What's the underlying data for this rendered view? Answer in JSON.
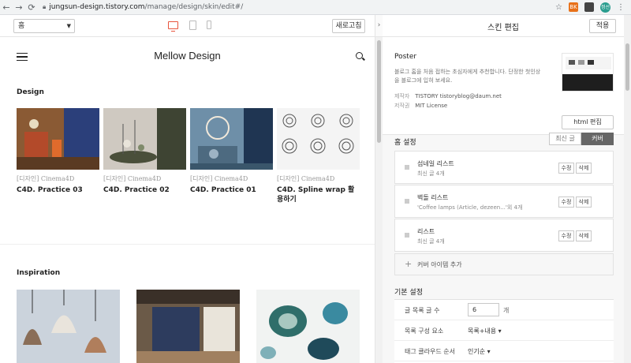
{
  "browser": {
    "back": "←",
    "forward": "→",
    "reload": "C",
    "url_domain": "jungsun-design.tistory.com",
    "url_path": "/manage/design/skin/edit#/",
    "ext1": "BK",
    "ext2": "",
    "avatar": "정선"
  },
  "toolbar": {
    "page_select": "홈",
    "refresh": "새로고침"
  },
  "preview": {
    "blog_title": "Mellow Design",
    "section_design": "Design",
    "section_inspiration": "Inspiration",
    "cards": [
      {
        "category": "[디자인] Cinema4D",
        "title": "C4D. Practice 03"
      },
      {
        "category": "[디자인] Cinema4D",
        "title": "C4D. Practice 02"
      },
      {
        "category": "[디자인] Cinema4D",
        "title": "C4D. Practice 01"
      },
      {
        "category": "[디자인] Cinema4D",
        "title": "C4D. Spline wrap 활용하기"
      }
    ]
  },
  "panel": {
    "title": "스킨 편집",
    "apply": "적용",
    "skin_name": "Poster",
    "skin_desc": "블로그 홈을 처음 접하는 초심자에게 추천합니다. 단정한 첫인상을 블로그에 입혀 보세요.",
    "maker_key": "제작자",
    "maker_value": "TISTORY tistoryblog@daum.net",
    "license_key": "저작권",
    "license_value": "MIT License",
    "html_edit": "html 편집",
    "home_settings": "홈 설정",
    "seg_recent": "최신 글",
    "seg_cover": "커버",
    "cover_items": [
      {
        "title": "섬네일 리스트",
        "sub": "최신 글 4개",
        "edit": "수정",
        "delete": "삭제"
      },
      {
        "title": "벽돌 리스트",
        "sub": "'Coffee lamps (Article, dezeen...'외 4개",
        "edit": "수정",
        "delete": "삭제"
      },
      {
        "title": "리스트",
        "sub": "최신 글 4개",
        "edit": "수정",
        "delete": "삭제"
      }
    ],
    "add_cover": "커버 아이템 추가",
    "basic_settings": "기본 설정",
    "rows": [
      {
        "key": "글 목록 글 수",
        "value": "6",
        "unit": "개"
      },
      {
        "key": "목록 구성 요소",
        "value": "목록+내용 ▾"
      },
      {
        "key": "태그 클라우드 순서",
        "value": "인기순 ▾"
      }
    ]
  },
  "colors": {
    "accent_device": "#e8543c",
    "cover_active": "#666666"
  }
}
